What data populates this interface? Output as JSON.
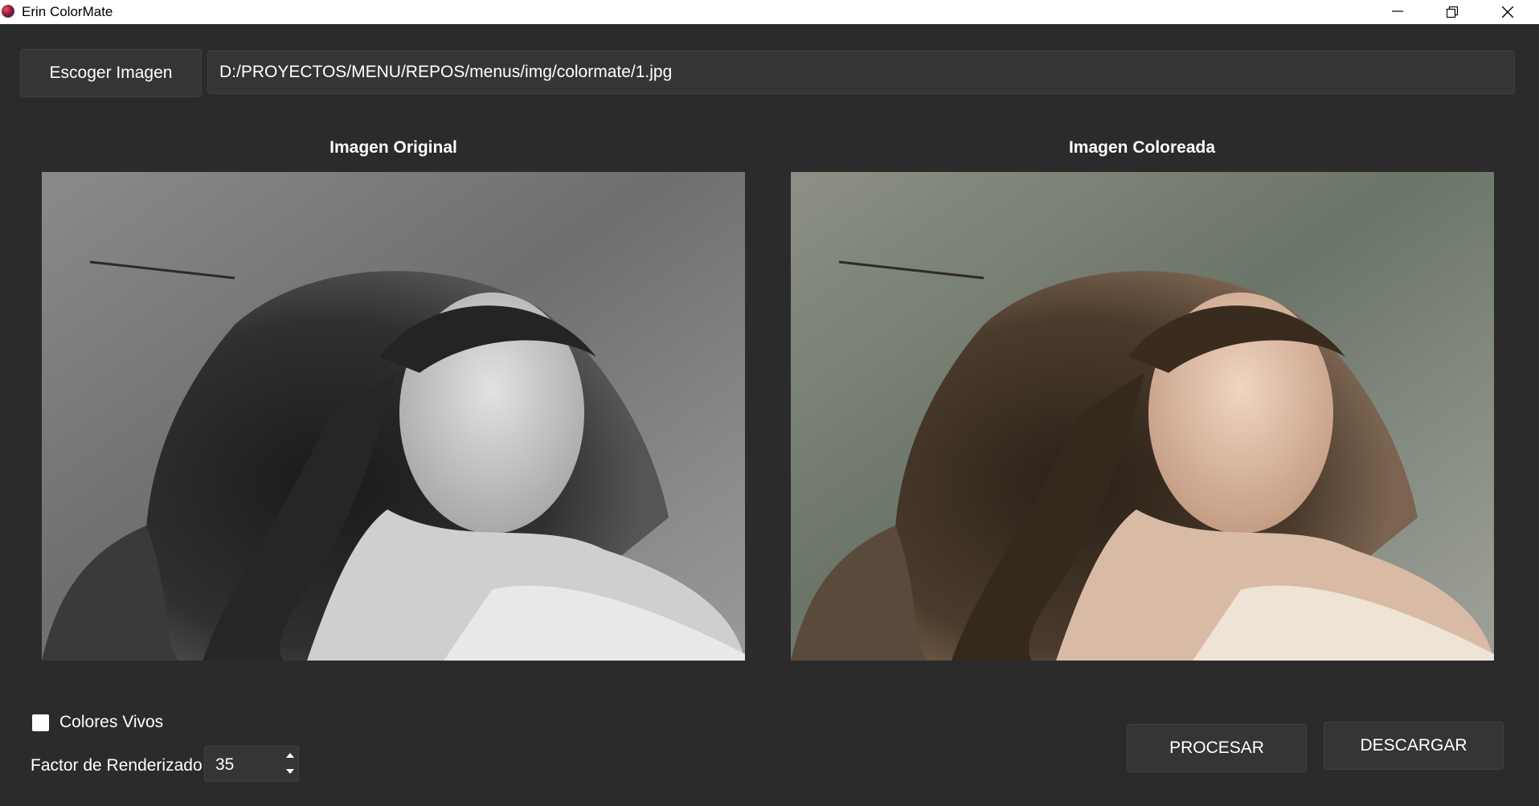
{
  "window": {
    "title": "Erin ColorMate",
    "icons": [
      "app-icon",
      "minimize-icon",
      "restore-icon",
      "close-icon"
    ]
  },
  "top_bar": {
    "choose_button_label": "Escoger Imagen",
    "path_value": "D:/PROYECTOS/MENU/REPOS/menus/img/colormate/1.jpg"
  },
  "panels": {
    "original_title": "Imagen Original",
    "colored_title": "Imagen Coloreada"
  },
  "options": {
    "vivid_colors_label": "Colores Vivos",
    "vivid_colors_checked": false,
    "render_factor_label": "Factor de Renderizado",
    "render_factor_value": "35"
  },
  "actions": {
    "process_label": "PROCESAR",
    "download_label": "DESCARGAR"
  },
  "colors": {
    "background": "#2b2b2b",
    "control": "#353535",
    "border": "#414141",
    "text": "#ffffff"
  }
}
